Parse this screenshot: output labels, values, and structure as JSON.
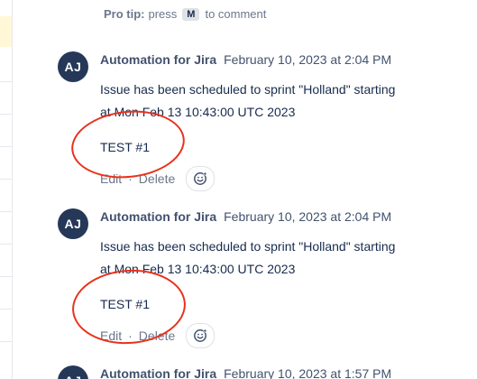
{
  "tip": {
    "prefix": "Pro tip:",
    "text1": "press",
    "key": "M",
    "text2": "to comment"
  },
  "comments": [
    {
      "avatar": "AJ",
      "author": "Automation for Jira",
      "date": "February 10, 2023 at 2:04 PM",
      "line1": "Issue has been scheduled to sprint \"Holland\" starting",
      "line2": "at Mon Feb 13 10:43:00 UTC 2023",
      "line3": "TEST #1",
      "edit": "Edit",
      "delete": "Delete",
      "reaction_icon": "smiley-icon"
    },
    {
      "avatar": "AJ",
      "author": "Automation for Jira",
      "date": "February 10, 2023 at 2:04 PM",
      "line1": "Issue has been scheduled to sprint \"Holland\" starting",
      "line2": "at Mon Feb 13 10:43:00 UTC 2023",
      "line3": "TEST #1",
      "edit": "Edit",
      "delete": "Delete",
      "reaction_icon": "smiley-icon"
    },
    {
      "avatar": "AJ",
      "author": "Automation for Jira",
      "date": "February 10, 2023 at 1:57 PM"
    }
  ],
  "colors": {
    "avatar_bg": "#253858",
    "annotation_circle": "#e8321d"
  }
}
